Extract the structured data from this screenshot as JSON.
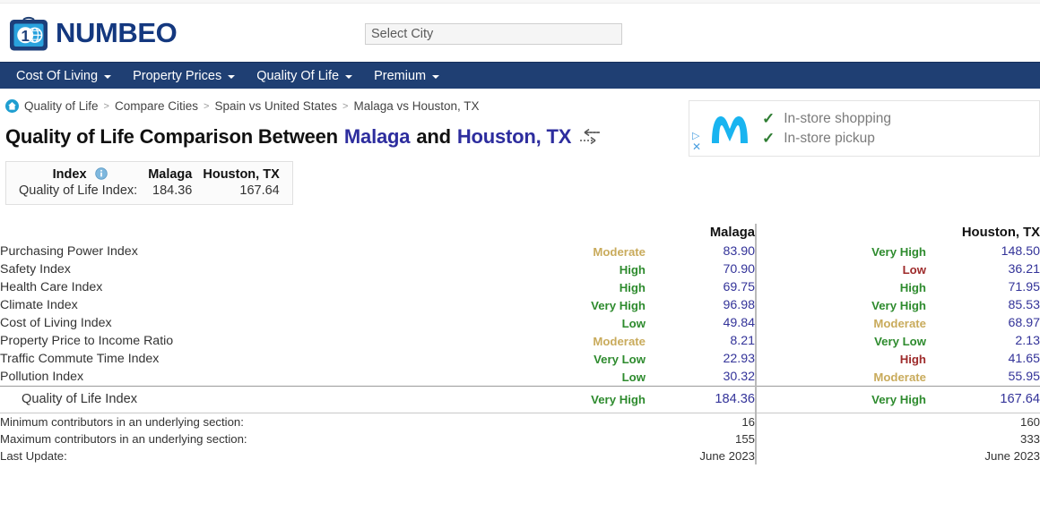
{
  "site": {
    "logo_text": "NUMBEO",
    "logo_icon": "numbeo-suitcase-globe-logo"
  },
  "search": {
    "placeholder": "Select City",
    "value": ""
  },
  "nav": {
    "items": [
      {
        "label": "Cost Of Living",
        "has_caret": true
      },
      {
        "label": "Property Prices",
        "has_caret": true
      },
      {
        "label": "Quality Of Life",
        "has_caret": true
      },
      {
        "label": "Premium",
        "has_caret": true
      }
    ]
  },
  "breadcrumb": {
    "home_icon": "home-icon",
    "separator": ">",
    "items": [
      "Quality of Life",
      "Compare Cities",
      "Spain vs United States",
      "Malaga vs Houston, TX"
    ]
  },
  "ad": {
    "logo_icon": "movistar-m-logo",
    "adchoices_icon": "adchoices-triangle-icon",
    "close_icon": "ad-close-icon",
    "lines": [
      "In-store shopping",
      "In-store pickup"
    ],
    "check_icon": "check-icon"
  },
  "title": {
    "prefix": "Quality of Life Comparison Between",
    "city_a": "Malaga",
    "conjunction": "and",
    "city_b": "Houston, TX",
    "swap_icon": "swap-cities-icon"
  },
  "index_box": {
    "header_index": "Index",
    "info_icon": "info-icon",
    "header_city_a": "Malaga",
    "header_city_b": "Houston, TX",
    "row_label": "Quality of Life Index:",
    "value_a": "184.36",
    "value_b": "167.64"
  },
  "table": {
    "header": {
      "name": "",
      "city_a": "Malaga",
      "city_b": "Houston, TX"
    },
    "rows": [
      {
        "name": "Purchasing Power Index",
        "a_rating": "Moderate",
        "a_class": "r-tan",
        "a_value": "83.90",
        "b_rating": "Very High",
        "b_class": "r-green",
        "b_value": "148.50"
      },
      {
        "name": "Safety Index",
        "a_rating": "High",
        "a_class": "r-green",
        "a_value": "70.90",
        "b_rating": "Low",
        "b_class": "r-red",
        "b_value": "36.21"
      },
      {
        "name": "Health Care Index",
        "a_rating": "High",
        "a_class": "r-green",
        "a_value": "69.75",
        "b_rating": "High",
        "b_class": "r-green",
        "b_value": "71.95"
      },
      {
        "name": "Climate Index",
        "a_rating": "Very High",
        "a_class": "r-green",
        "a_value": "96.98",
        "b_rating": "Very High",
        "b_class": "r-green",
        "b_value": "85.53"
      },
      {
        "name": "Cost of Living Index",
        "a_rating": "Low",
        "a_class": "r-green",
        "a_value": "49.84",
        "b_rating": "Moderate",
        "b_class": "r-tan",
        "b_value": "68.97"
      },
      {
        "name": "Property Price to Income Ratio",
        "a_rating": "Moderate",
        "a_class": "r-tan",
        "a_value": "8.21",
        "b_rating": "Very Low",
        "b_class": "r-green",
        "b_value": "2.13"
      },
      {
        "name": "Traffic Commute Time Index",
        "a_rating": "Very Low",
        "a_class": "r-green",
        "a_value": "22.93",
        "b_rating": "High",
        "b_class": "r-red",
        "b_value": "41.65"
      },
      {
        "name": "Pollution Index",
        "a_rating": "Low",
        "a_class": "r-green",
        "a_value": "30.32",
        "b_rating": "Moderate",
        "b_class": "r-tan",
        "b_value": "55.95"
      }
    ],
    "summary_row": {
      "name": "Quality of Life Index",
      "a_rating": "Very High",
      "a_class": "r-green",
      "a_value": "184.36",
      "b_rating": "Very High",
      "b_class": "r-green",
      "b_value": "167.64"
    },
    "footer_rows": [
      {
        "label": "Minimum contributors in an underlying section:",
        "a_value": "16",
        "b_value": "160"
      },
      {
        "label": "Maximum contributors in an underlying section:",
        "a_value": "155",
        "b_value": "333"
      },
      {
        "label": "Last Update:",
        "a_value": "June 2023",
        "b_value": "June 2023"
      }
    ]
  },
  "colors": {
    "nav_bg": "#1f3f73",
    "brand": "#14387f",
    "value_text": "#333399",
    "rating_good": "#2e8b2e",
    "rating_bad": "#9e2b2b",
    "rating_moderate": "#c9ab5c"
  }
}
